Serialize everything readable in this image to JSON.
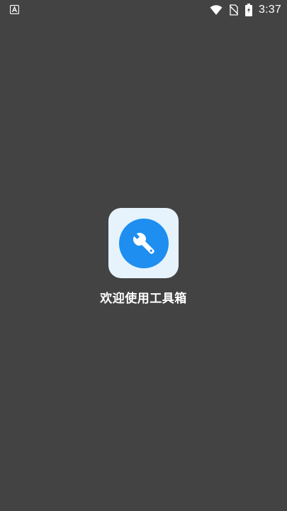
{
  "status_bar": {
    "notification_icon": "app-notification-icon",
    "wifi_icon": "wifi-icon",
    "sim_icon": "no-sim-icon",
    "battery_icon": "battery-charging-icon",
    "time": "3:37"
  },
  "splash": {
    "logo_icon": "wrench-icon",
    "welcome_text": "欢迎使用工具箱"
  },
  "colors": {
    "background": "#434343",
    "logo_tile": "#e6f3fd",
    "accent": "#1e8ef0",
    "text": "#ffffff"
  }
}
